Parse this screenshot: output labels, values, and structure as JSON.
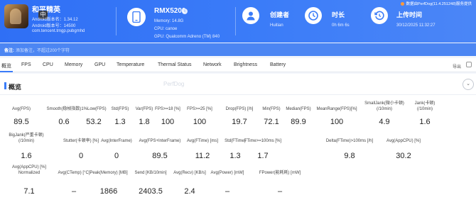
{
  "header": {
    "game": {
      "name": "和平精英",
      "lang_badge": "中",
      "android_version": "Android版本名：1.34.12",
      "android_code": "Android版本号：14500",
      "package": "com.tencent.tmgp.pubgmhd"
    },
    "device": {
      "name": "RMX5200",
      "info_badge": "i",
      "memory": "Memory: 14.8G",
      "cpu": "CPU: canoe",
      "gpu": "GPU: Qualcomm Adreno (TM) 840"
    },
    "creator": {
      "label": "创建者",
      "value": "Huitian"
    },
    "duration": {
      "label": "时长",
      "value": "0h 6m 6s"
    },
    "upload": {
      "label": "上传时间",
      "value": "30/12/2025 11:32:27"
    },
    "perfdog_tag": "数据由PerfDog(11.4.251248)服务提供"
  },
  "notes": {
    "label": "备注:",
    "placeholder": "添加备注，不超过200个字符"
  },
  "tabs": [
    "概览",
    "FPS",
    "CPU",
    "Memory",
    "GPU",
    "Temperature",
    "Thermal Status",
    "Network",
    "Brightness",
    "Battery"
  ],
  "export_label": "导出",
  "overview": {
    "title": "概览",
    "watermark": "PerfDog",
    "collapse_icon": "chevron-down",
    "metrics": [
      {
        "label": "Avg(FPS)",
        "value": "89.5"
      },
      {
        "label": "Smooth(稳帧指数)",
        "value": "0.6"
      },
      {
        "label": "1%Low(FPS)",
        "value": "53.2"
      },
      {
        "label": "Std(FPS)",
        "value": "1.3"
      },
      {
        "label": "Var(FPS)",
        "value": "1.8"
      },
      {
        "label": "FPS>=18 [%]",
        "value": "100"
      },
      {
        "label": "FPS>=25 [%]",
        "value": "100"
      },
      {
        "label": "Drop(FPS) [/h]",
        "value": "19.7"
      },
      {
        "label": "Min(FPS)",
        "value": "72.1"
      },
      {
        "label": "Median(FPS)",
        "value": "89.9"
      },
      {
        "label": "MeanRange(FPS)[%]",
        "value": "100"
      },
      {
        "label": "SmallJank(微小卡顿)\n(/10min)",
        "value": "4.9"
      },
      {
        "label": "Jank(卡顿)\n(/10min)",
        "value": "1.6"
      },
      {
        "label": "BigJank(严重卡顿)\n(/10min)",
        "value": "1.6"
      },
      {
        "label": "Stutter(卡顿率) [%]",
        "value": "0"
      },
      {
        "label": "Avg(InterFrame)",
        "value": "0"
      },
      {
        "label": "Avg(FPS+InterFrame)",
        "value": "89.5"
      },
      {
        "label": "Avg(FTime) [ms]",
        "value": "11.2"
      },
      {
        "label": "Std(FTime)",
        "value": "1.3"
      },
      {
        "label": "FTime>=100ms [%]",
        "value": "1.7"
      },
      {
        "label": "Delta(FTime)>100ms [/h]",
        "value": "9.8"
      },
      {
        "label": "Avg(AppCPU) [%]",
        "value": "30.2"
      },
      {
        "label": "Avg(AppCPU) [%]\nNormalized",
        "value": "7.1"
      },
      {
        "label": "Avg(CTemp) [°C]",
        "value": "–"
      },
      {
        "label": "Peak(Memory) [MB]",
        "value": "1866"
      },
      {
        "label": "Send [KB/10min]",
        "value": "2403.5"
      },
      {
        "label": "Avg(Recv) [KB/s]",
        "value": "2.4"
      },
      {
        "label": "Avg(Power) [mW]",
        "value": "–"
      },
      {
        "label": "FPower(能耗耗) [mW]",
        "value": "–"
      }
    ]
  }
}
